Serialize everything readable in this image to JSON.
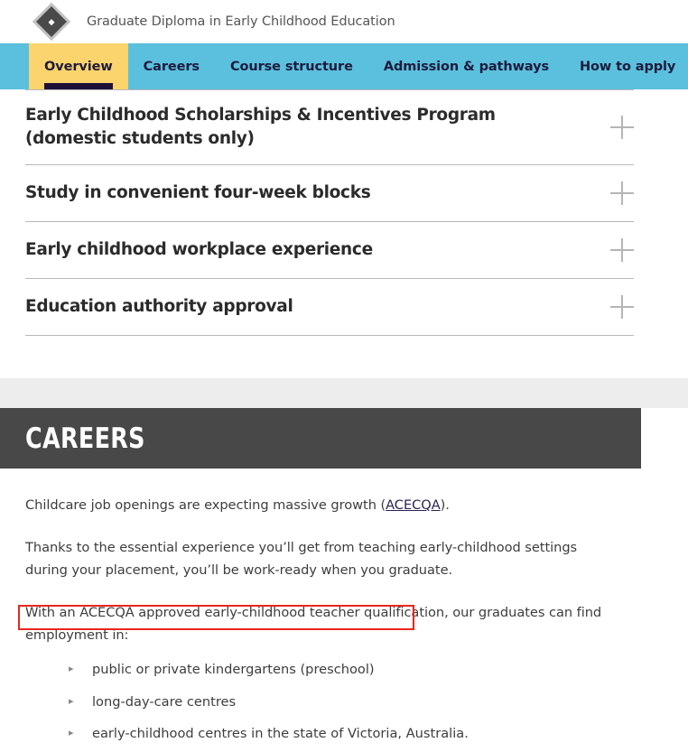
{
  "header": {
    "logo_icon": "diamond-logo-icon",
    "title": "Graduate Diploma in Early Childhood Education"
  },
  "nav": {
    "active_tab": "Overview",
    "tabs": [
      {
        "label": "Overview",
        "active": true
      },
      {
        "label": "Careers",
        "active": false
      },
      {
        "label": "Course structure",
        "active": false
      },
      {
        "label": "Admission & pathways",
        "active": false
      },
      {
        "label": "How to apply",
        "active": false
      }
    ]
  },
  "accordion": {
    "items": [
      {
        "title": "Early Childhood Scholarships & Incentives Program (domestic students only)",
        "expand_icon": "plus-icon"
      },
      {
        "title": "Study in convenient four-week blocks",
        "expand_icon": "plus-icon"
      },
      {
        "title": "Early childhood workplace experience",
        "expand_icon": "plus-icon"
      },
      {
        "title": "Education authority approval",
        "expand_icon": "plus-icon"
      }
    ]
  },
  "careers": {
    "section_title": "CAREERS",
    "paragraph_1_pre": "Childcare job openings are expecting massive growth (",
    "paragraph_1_link": "ACECQA",
    "paragraph_1_post": ").",
    "paragraph_2": "Thanks to the essential experience you’ll get from teaching early-childhood settings during your placement, you’ll be work-ready when you graduate.",
    "paragraph_3": "With an ACECQA approved early-childhood teacher qualification, our graduates can find employment in:",
    "list_items": [
      "public or private kindergartens (preschool)",
      "long-day-care centres",
      "early-childhood centres in the state of Victoria, Australia."
    ],
    "bullet_marker": "▸"
  },
  "colors": {
    "nav_blue": "#5bc0de",
    "active_tab_yellow": "#fbd46d",
    "active_tab_underline": "#1e1139",
    "banner_dark": "#484848",
    "gray_band": "#ededed",
    "highlight_red": "#e8271b",
    "link_purple": "#2b2352"
  }
}
